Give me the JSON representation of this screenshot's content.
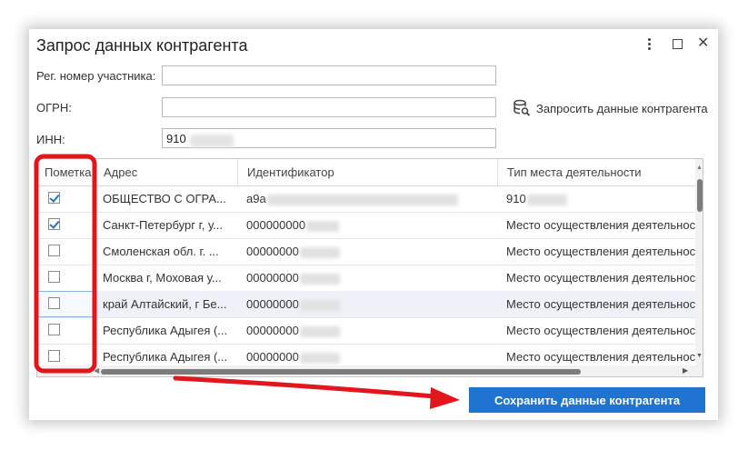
{
  "dialog": {
    "title": "Запрос данных контрагента",
    "controls": {
      "menu": "more-options",
      "maximize": "maximize",
      "close": "✕"
    }
  },
  "form": {
    "reg_number": {
      "label": "Рег. номер участника:",
      "value": ""
    },
    "ogrn": {
      "label": "ОГРН:",
      "value": ""
    },
    "inn": {
      "label": "ИНН:",
      "value": "910"
    }
  },
  "query_button": {
    "label": "Запросить данные контрагента",
    "icon": "database-search-icon"
  },
  "grid": {
    "columns": [
      "Пометка",
      "Адрес",
      "Идентификатор",
      "Тип места деятельности"
    ],
    "rows": [
      {
        "checked": true,
        "address": "ОБЩЕСТВО С ОГРА...",
        "id": "a9a",
        "type": "910"
      },
      {
        "checked": true,
        "address": "Санкт-Петербург г, у...",
        "id": "000000000",
        "type": "Место осуществления деятельности"
      },
      {
        "checked": false,
        "address": "Смоленская обл. г. ...",
        "id": "00000000",
        "type": "Место осуществления деятельности"
      },
      {
        "checked": false,
        "address": "Москва г, Моховая у...",
        "id": "00000000",
        "type": "Место осуществления деятельности"
      },
      {
        "checked": false,
        "address": "край Алтайский, г Бе...",
        "id": "00000000",
        "type": "Место осуществления деятельности",
        "selected": true
      },
      {
        "checked": false,
        "address": "Республика Адыгея (...",
        "id": "00000000",
        "type": "Место осуществления деятельности"
      },
      {
        "checked": false,
        "address": "Республика Адыгея (...",
        "id": "00000000",
        "type": "Место осуществления деятельности"
      }
    ]
  },
  "save_button": {
    "label": "Сохранить данные контрагента"
  },
  "colors": {
    "accent": "#1e74d0",
    "annotation": "#e3161b",
    "check": "#1f72c9"
  }
}
